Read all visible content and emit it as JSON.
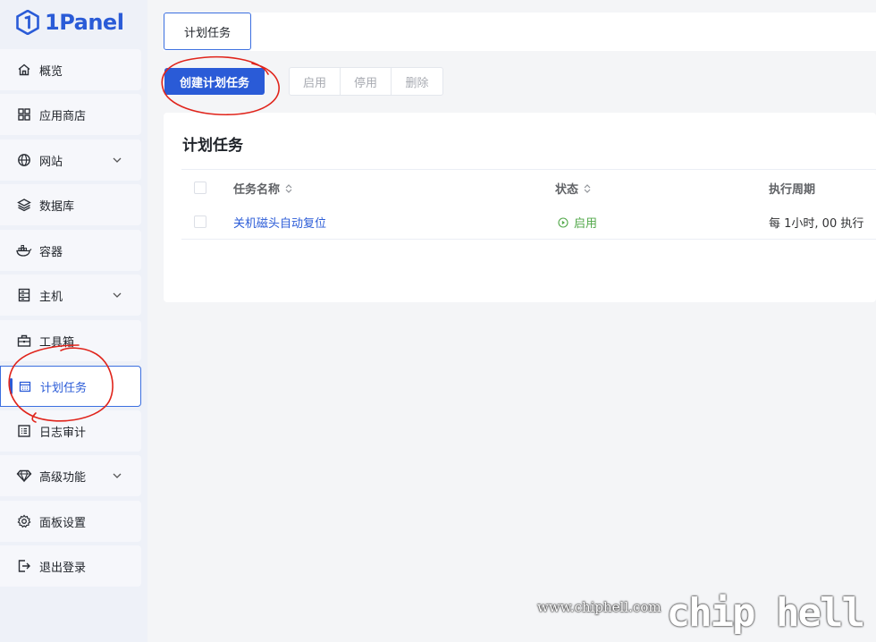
{
  "app": {
    "brand": "1Panel"
  },
  "sidebar": {
    "items": [
      {
        "label": "概览",
        "icon": "home-icon",
        "has_children": false
      },
      {
        "label": "应用商店",
        "icon": "grid-icon",
        "has_children": false
      },
      {
        "label": "网站",
        "icon": "globe-icon",
        "has_children": true
      },
      {
        "label": "数据库",
        "icon": "layers-icon",
        "has_children": false
      },
      {
        "label": "容器",
        "icon": "docker-icon",
        "has_children": false
      },
      {
        "label": "主机",
        "icon": "server-icon",
        "has_children": true
      },
      {
        "label": "工具箱",
        "icon": "toolbox-icon",
        "has_children": false
      },
      {
        "label": "计划任务",
        "icon": "calendar-icon",
        "has_children": false,
        "active": true
      },
      {
        "label": "日志审计",
        "icon": "log-icon",
        "has_children": false
      },
      {
        "label": "高级功能",
        "icon": "diamond-icon",
        "has_children": true
      },
      {
        "label": "面板设置",
        "icon": "gear-icon",
        "has_children": false
      },
      {
        "label": "退出登录",
        "icon": "logout-icon",
        "has_children": false
      }
    ]
  },
  "header": {
    "active_tab": "计划任务"
  },
  "toolbar": {
    "create_label": "创建计划任务",
    "enable_label": "启用",
    "disable_label": "停用",
    "delete_label": "删除"
  },
  "card": {
    "title": "计划任务",
    "columns": [
      "任务名称",
      "状态",
      "执行周期"
    ],
    "rows": [
      {
        "name": "关机磁头自动复位",
        "status": "启用",
        "cycle": "每 1小时, 00 执行"
      }
    ]
  },
  "colors": {
    "accent": "#2a5bd7",
    "status_enabled": "#52a84a",
    "annotation": "#e0241b"
  },
  "watermark": {
    "url": "www.chiphell.com",
    "logo": "chip hell"
  }
}
